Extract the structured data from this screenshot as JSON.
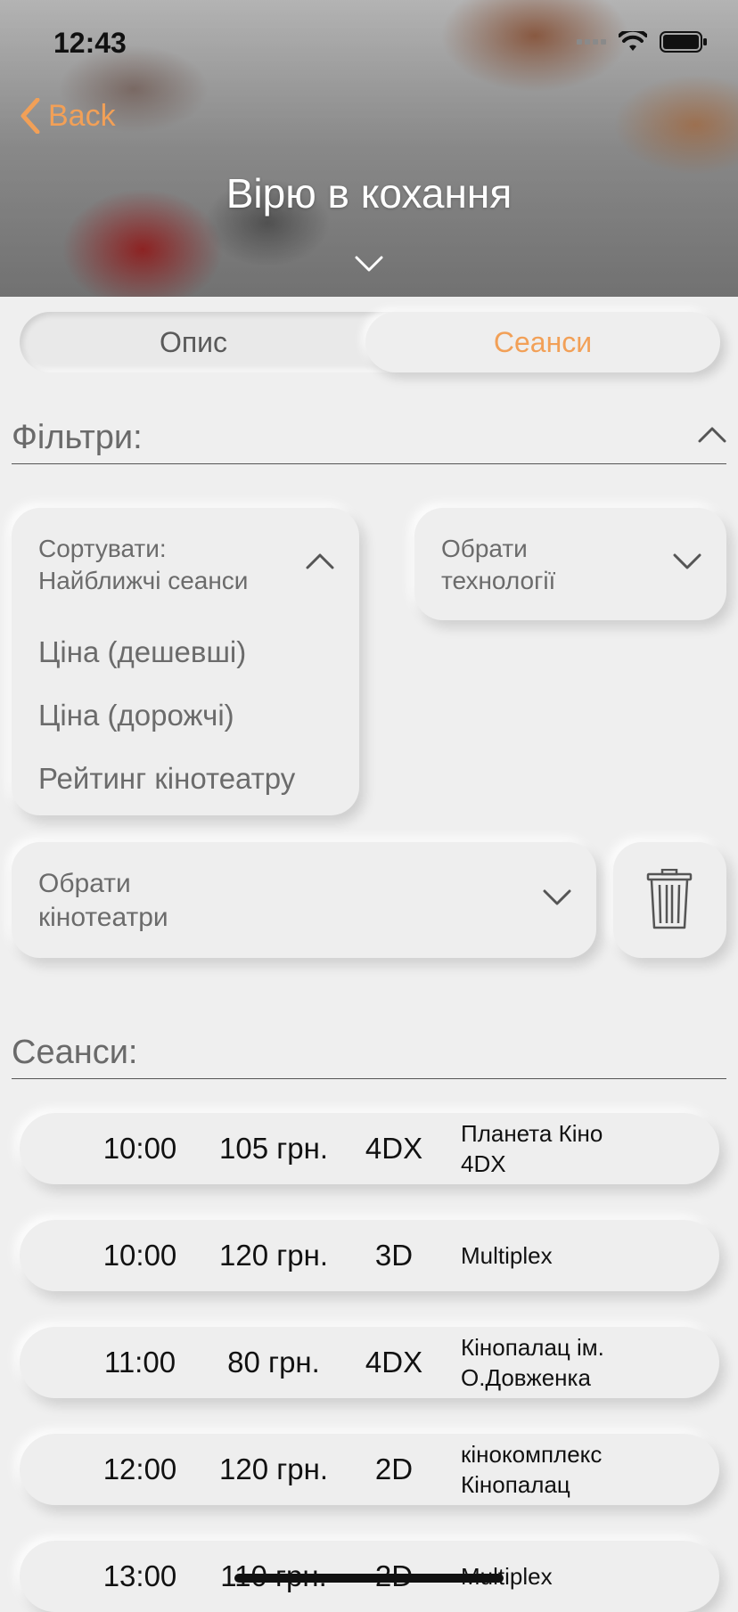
{
  "status_bar": {
    "time": "12:43"
  },
  "nav": {
    "back_label": "Back",
    "title": "Вірю в кохання"
  },
  "tabs": [
    {
      "label": "Опис",
      "selected": false
    },
    {
      "label": "Сеанси",
      "selected": true
    }
  ],
  "filters": {
    "header": "Фільтри:",
    "sort": {
      "label_line1": "Сортувати:",
      "label_line2": "Найближчі сеанси",
      "options": [
        "Ціна (дешевші)",
        "Ціна (дорожчі)",
        "Рейтинг кінотеатру"
      ]
    },
    "technology": {
      "line1": "Обрати",
      "line2": "технології"
    },
    "cinemas": {
      "line1": "Обрати",
      "line2": "кінотеатри"
    }
  },
  "sessions_header": "Сеанси:",
  "sessions": [
    {
      "time": "10:00",
      "price": "105 грн.",
      "tech": "4DX",
      "cinema_line1": "Планета Кіно",
      "cinema_line2": "4DX"
    },
    {
      "time": "10:00",
      "price": "120 грн.",
      "tech": "3D",
      "cinema_line1": "Multiplex",
      "cinema_line2": ""
    },
    {
      "time": "11:00",
      "price": "80 грн.",
      "tech": "4DX",
      "cinema_line1": "Кінопалац ім.",
      "cinema_line2": "О.Довженка"
    },
    {
      "time": "12:00",
      "price": "120 грн.",
      "tech": "2D",
      "cinema_line1": "кінокомплекс",
      "cinema_line2": "Кінопалац"
    },
    {
      "time": "13:00",
      "price": "110 грн.",
      "tech": "2D",
      "cinema_line1": "Multiplex",
      "cinema_line2": ""
    }
  ],
  "colors": {
    "accent": "#f2a057",
    "background": "#efefef",
    "text_muted": "#6b6b6b"
  },
  "icons": [
    "chevron-left-icon",
    "chevron-down-icon",
    "chevron-up-icon",
    "trash-icon",
    "wifi-icon",
    "battery-icon",
    "signal-icon"
  ]
}
